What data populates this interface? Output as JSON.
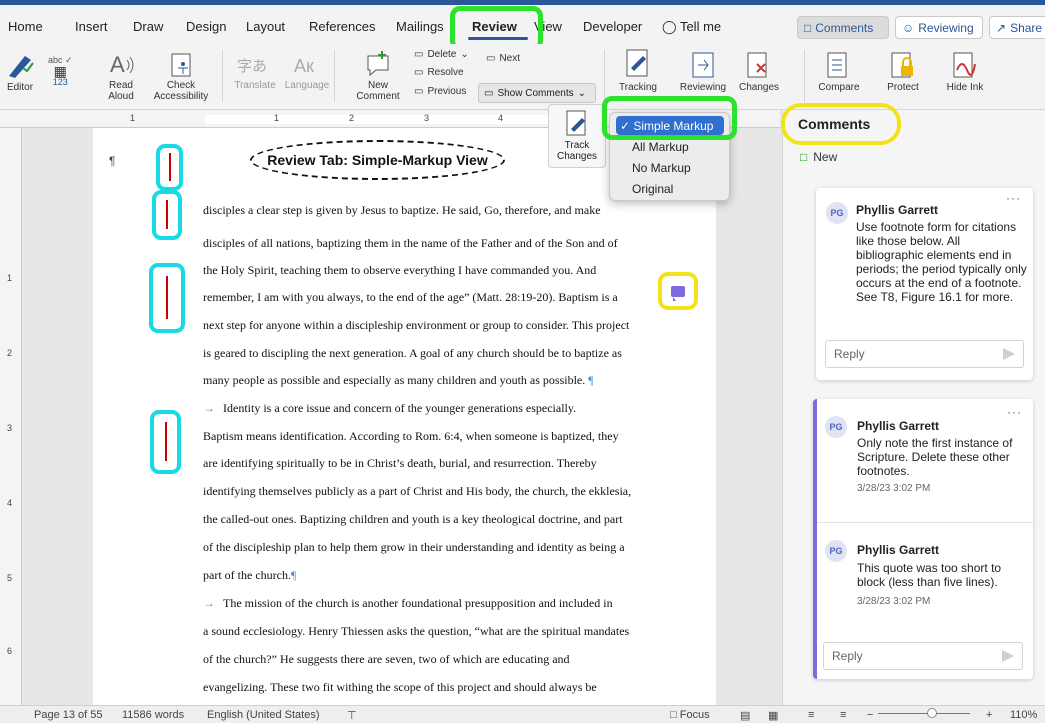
{
  "tabs": [
    "Home",
    "Insert",
    "Draw",
    "Design",
    "Layout",
    "References",
    "Mailings",
    "Review",
    "View",
    "Developer"
  ],
  "tell_me": "Tell me",
  "header_buttons": {
    "comments": "Comments",
    "reviewing": "Reviewing",
    "share": "Share"
  },
  "ribbon": {
    "editor": "Editor",
    "read_aloud": "Read Aloud",
    "check_accessibility": "Check Accessibility",
    "translate": "Translate",
    "language": "Language",
    "new_comment": "New Comment",
    "delete": "Delete",
    "resolve": "Resolve",
    "previous": "Previous",
    "next": "Next",
    "show_comments": "Show Comments",
    "tracking": "Tracking",
    "reviewing": "Reviewing",
    "changes": "Changes",
    "compare": "Compare",
    "protect": "Protect",
    "hide_ink": "Hide Ink",
    "track_changes": "Track Changes"
  },
  "markup_menu": {
    "items": [
      "Simple Markup",
      "All Markup",
      "No Markup",
      "Original"
    ],
    "selected": "Simple Markup"
  },
  "ruler": {
    "h": [
      "1",
      "1",
      "2",
      "3",
      "4"
    ],
    "v": [
      "1",
      "2",
      "3",
      "4",
      "5",
      "6"
    ]
  },
  "document": {
    "title": "Review Tab: Simple-Markup View",
    "lines": [
      {
        "text": "disciples a clear step is given by Jesus to baptize. He said, Go, therefore, and make"
      },
      {
        "text": "disciples of all nations, baptizing them in the name of the Father and of the Son and of"
      },
      {
        "text": "the Holy Spirit, teaching them to observe everything I have commanded you. And"
      },
      {
        "text": "remember, I am with you always, to the end of the age” (Matt. 28:19-20). Baptism is a"
      },
      {
        "text": "next step for anyone within a discipleship environment or group to consider. This project"
      },
      {
        "text": "is geared to discipling the next generation. A goal of any church should be to baptize as"
      },
      {
        "text": "many people as possible and especially as many children and youth as possible."
      },
      {
        "text": "Identity is a core issue and concern of the younger generations especially."
      },
      {
        "text": "Baptism means identification. According to Rom. 6:4, when someone is baptized, they"
      },
      {
        "text": "are identifying spiritually to be in Christ’s death, burial, and resurrection. Thereby"
      },
      {
        "text": "identifying themselves publicly as a part of Christ and His body, the church, the ekklesia,"
      },
      {
        "text": "the called-out ones. Baptizing children and youth is a key theological doctrine, and part"
      },
      {
        "text": "of the discipleship plan to help them grow in their understanding and identity as being a"
      },
      {
        "text": "part of the church."
      },
      {
        "text": "The mission of the church is another foundational presupposition and included in"
      },
      {
        "text": "a sound ecclesiology. Henry Thiessen asks the question, “what are the spiritual mandates"
      },
      {
        "text": "of the church?” He suggests there are seven, two of which are educating and"
      },
      {
        "text": "evangelizing. These two fit withing the scope of this project and should always be"
      }
    ]
  },
  "comments_pane": {
    "title": "Comments",
    "new_label": "New",
    "reply_placeholder": "Reply",
    "threads": [
      {
        "initials": "PG",
        "author": "Phyllis Garrett",
        "text": "Use footnote form for citations like those below. All bibliographic elements end in periods; the period typically only occurs at the end of a footnote. See T8, Figure 16.1 for more.",
        "time": ""
      },
      {
        "initials": "PG",
        "author": "Phyllis Garrett",
        "text": "Only note the first instance of Scripture. Delete these other footnotes.",
        "time": "3/28/23 3:02 PM"
      },
      {
        "initials": "PG",
        "author": "Phyllis Garrett",
        "text": "This quote was too short to block (less than five lines).",
        "time": "3/28/23 3:02 PM"
      }
    ]
  },
  "status_bar": {
    "page": "Page 13 of 55",
    "words": "11586 words",
    "language": "English (United States)",
    "focus": "Focus",
    "zoom": "110%"
  },
  "colors": {
    "accent": "#2b579a",
    "highlight_green": "#2de22d",
    "highlight_yellow": "#f3e21a",
    "highlight_cyan": "#18d9e6",
    "comment_purple": "#7b6be0"
  }
}
